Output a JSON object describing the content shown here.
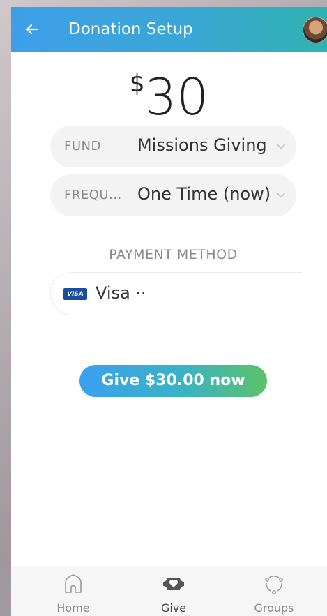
{
  "header": {
    "title": "Donation Setup",
    "back_icon": "arrow-left-icon"
  },
  "amount": {
    "symbol": "$",
    "value": "30"
  },
  "fund": {
    "label": "FUND",
    "value": "Missions Giving"
  },
  "frequency": {
    "label": "FREQU...",
    "value": "One Time (now)"
  },
  "payment": {
    "section_label": "PAYMENT METHOD",
    "card_brand": "VISA",
    "card_text": "Visa ··"
  },
  "give_button": {
    "label": "Give $30.00 now"
  },
  "tabs": [
    {
      "label": "Home",
      "icon": "home-icon"
    },
    {
      "label": "Give",
      "icon": "give-icon"
    },
    {
      "label": "Groups",
      "icon": "groups-icon"
    }
  ],
  "colors": {
    "header_start": "#3e9fe8",
    "header_end": "#2fb3b0",
    "button_start": "#3aa0f0",
    "button_end": "#5cc269",
    "visa_blue": "#1a4da0"
  }
}
